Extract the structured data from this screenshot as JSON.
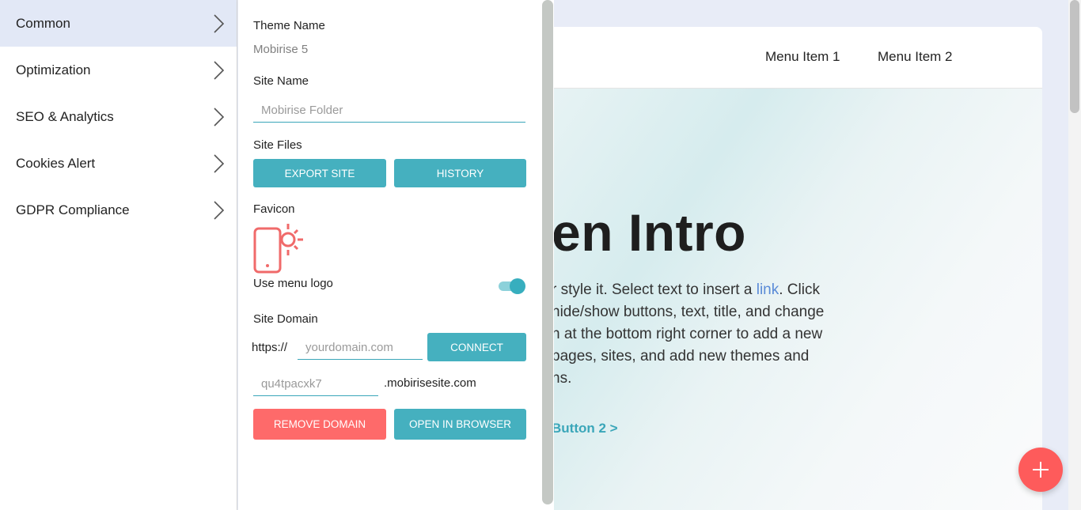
{
  "sidebar": {
    "items": [
      {
        "label": "Common"
      },
      {
        "label": "Optimization"
      },
      {
        "label": "SEO & Analytics"
      },
      {
        "label": "Cookies Alert"
      },
      {
        "label": "GDPR Compliance"
      }
    ]
  },
  "settings": {
    "theme_name_label": "Theme Name",
    "theme_name_value": "Mobirise 5",
    "site_name_label": "Site Name",
    "site_name_value": "Mobirise Folder",
    "site_files_label": "Site Files",
    "export_button": "EXPORT SITE",
    "history_button": "HISTORY",
    "favicon_label": "Favicon",
    "use_menu_logo_label": "Use menu logo",
    "use_menu_logo_enabled": true,
    "site_domain_label": "Site Domain",
    "domain_prefix": "https://",
    "domain_placeholder": "yourdomain.com",
    "connect_button": "CONNECT",
    "subdomain_value": "qu4tpacxk7",
    "subdomain_suffix": ".mobirisesite.com",
    "remove_domain_button": "REMOVE DOMAIN",
    "open_in_browser_button": "OPEN IN BROWSER"
  },
  "preview": {
    "menu_items": [
      "Menu Item 1",
      "Menu Item 2"
    ],
    "hero_title": "en Intro",
    "hero_text_lines": [
      {
        "before": "r style it. Select text to insert a ",
        "link": "link",
        "after": ". Click"
      },
      {
        "before": "hide/show buttons, text, title, and change",
        "link": "",
        "after": ""
      },
      {
        "before": "n at the bottom right corner to add a new",
        "link": "",
        "after": ""
      },
      {
        "before": "pages, sites, and add new themes and",
        "link": "",
        "after": ""
      },
      {
        "before": "ns.",
        "link": "",
        "after": ""
      }
    ],
    "button2_label": "Button 2 >"
  },
  "colors": {
    "accent": "#45b0bf",
    "danger": "#fe6a6a",
    "fab": "#fe5b5b",
    "active_menu_bg": "#e2e8f6"
  },
  "icons": {
    "chevron": "chevron-right-icon",
    "favicon": "phone-sun-icon",
    "fab": "plus-icon"
  }
}
